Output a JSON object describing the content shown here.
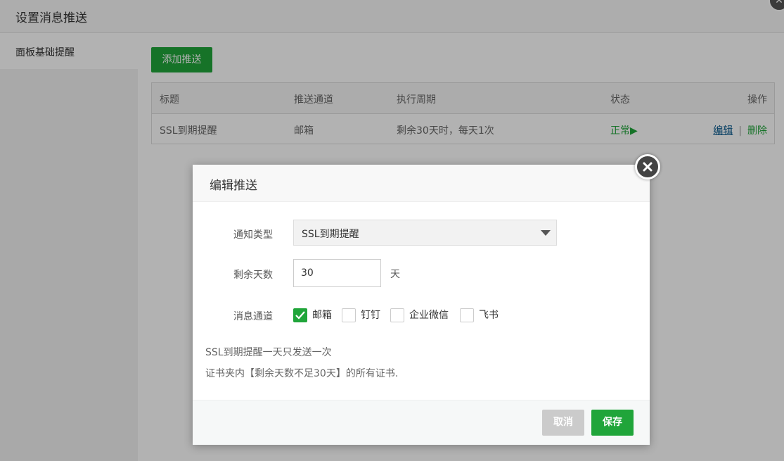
{
  "outer": {
    "title": "设置消息推送",
    "nav_items": [
      "面板基础提醒"
    ],
    "add_button": "添加推送",
    "table": {
      "headers": [
        "标题",
        "推送通道",
        "执行周期",
        "状态",
        "操作"
      ],
      "rows": [
        {
          "title": "SSL到期提醒",
          "channel": "邮箱",
          "schedule": "剩余30天时，每天1次",
          "status": "正常▶",
          "edit": "编辑",
          "sep": "|",
          "delete": "删除"
        }
      ]
    }
  },
  "modal": {
    "title": "编辑推送",
    "notify_type_label": "通知类型",
    "notify_type_value": "SSL到期提醒",
    "days_label": "剩余天数",
    "days_value": "30",
    "days_unit": "天",
    "channel_label": "消息通道",
    "channels": [
      {
        "label": "邮箱",
        "checked": true
      },
      {
        "label": "钉钉",
        "checked": false
      },
      {
        "label": "企业微信",
        "checked": false
      },
      {
        "label": "飞书",
        "checked": false
      }
    ],
    "tip1": "SSL到期提醒一天只发送一次",
    "tip2": "证书夹内【剩余天数不足30天】的所有证书.",
    "cancel": "取消",
    "save": "保存"
  },
  "colors": {
    "accent": "#20a53a",
    "cancel": "#cbcbcb",
    "link": "#07588d"
  }
}
